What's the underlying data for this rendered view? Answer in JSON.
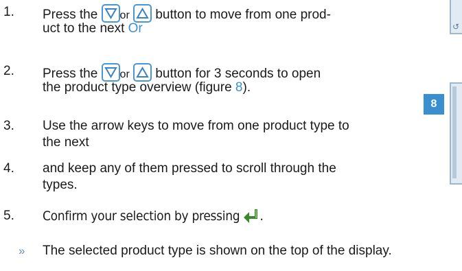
{
  "steps": [
    {
      "num": "1.",
      "line1_pre": "Press the",
      "or_text": "or",
      "line1_post": "button to move from one prod-",
      "line2": "uct to the next",
      "line2_suffix": "Or"
    },
    {
      "num": "2.",
      "line1_pre": "Press the",
      "or_text": "or",
      "line1_post": "button for 3 seconds to open",
      "line2_pre": "the product type overview (figure",
      "fig_ref": "8",
      "line2_post": ")."
    },
    {
      "num": "3.",
      "line1": "Use the arrow keys to move from one product type to",
      "line2": "the next"
    },
    {
      "num": "4.",
      "line1": "and keep any of them pressed to scroll through the",
      "line2": "types."
    },
    {
      "num": "5.",
      "line1": "Confirm your selection by pressing",
      "line1_post": "."
    }
  ],
  "result": {
    "marker": "»",
    "text": "The selected product type is shown on the top of the display."
  },
  "figure_badge": "8",
  "icons": {
    "down": "down-arrow-button-icon",
    "up": "up-arrow-button-icon",
    "enter": "enter-key-icon"
  },
  "colors": {
    "accent": "#3a8fd0",
    "text": "#1a1a1a"
  }
}
